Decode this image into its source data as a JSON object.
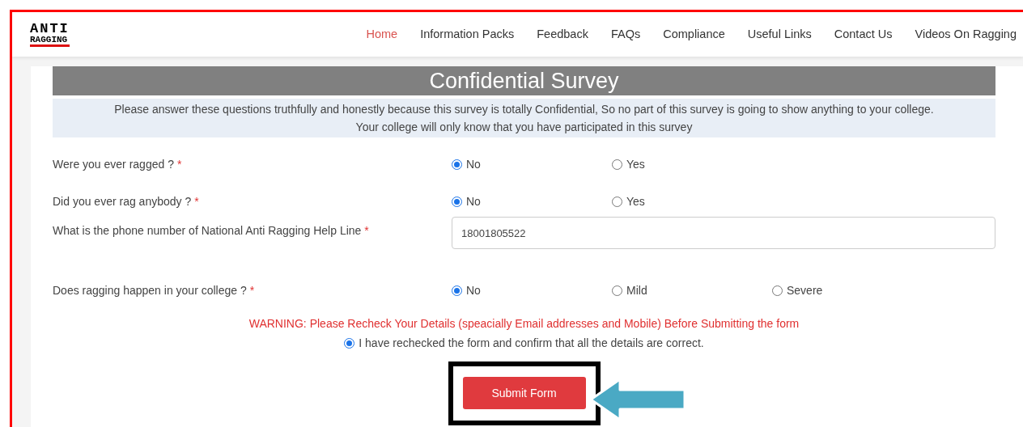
{
  "logo": {
    "line1": "ANTI",
    "line2": "RAGGING"
  },
  "nav": [
    {
      "label": "Home",
      "selected": true
    },
    {
      "label": "Information Packs",
      "selected": false
    },
    {
      "label": "Feedback",
      "selected": false
    },
    {
      "label": "FAQs",
      "selected": false
    },
    {
      "label": "Compliance",
      "selected": false
    },
    {
      "label": "Useful Links",
      "selected": false
    },
    {
      "label": "Contact Us",
      "selected": false
    },
    {
      "label": "Videos On Ragging",
      "selected": false
    }
  ],
  "survey": {
    "title": "Confidential Survey",
    "notice": [
      "Please answer these questions truthfully and honestly because this survey is totally Confidential, So no part of this survey is going to show anything to your college.",
      "Your college will only know that you have participated in this survey"
    ],
    "questions": [
      {
        "kind": "radio",
        "label": "Were you ever ragged ?",
        "required_mark": "*",
        "options": [
          {
            "label": "No",
            "selected": true
          },
          {
            "label": "Yes",
            "selected": false
          }
        ]
      },
      {
        "kind": "radio",
        "label": "Did you ever rag anybody ?",
        "required_mark": "*",
        "options": [
          {
            "label": "No",
            "selected": true
          },
          {
            "label": "Yes",
            "selected": false
          }
        ]
      },
      {
        "kind": "text",
        "label": "What is the phone number of National Anti Ragging Help Line",
        "required_mark": "*",
        "value": "18001805522"
      },
      {
        "kind": "radio",
        "label": "Does ragging happen in your college ?",
        "required_mark": "*",
        "options": [
          {
            "label": "No",
            "selected": true
          },
          {
            "label": "Mild",
            "selected": false
          },
          {
            "label": "Severe",
            "selected": false
          }
        ]
      }
    ],
    "warning": "WARNING: Please Recheck Your Details (speacially Email addresses and Mobile) Before Submitting the form",
    "confirm": {
      "label": "I have rechecked the form and confirm that all the details are correct.",
      "selected": true
    },
    "submit": "Submit Form",
    "submit_highlighted": true
  }
}
